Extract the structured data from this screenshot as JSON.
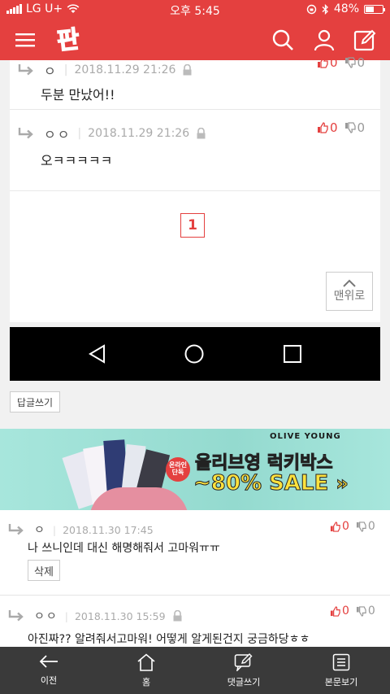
{
  "status_bar": {
    "carrier": "LG U+",
    "time": "오후 5:45",
    "battery": "48%",
    "battery_level": 0.48
  },
  "header": {
    "logo_text": "판",
    "icons": [
      "menu-icon",
      "search-icon",
      "user-icon",
      "write-icon"
    ]
  },
  "comments_top": [
    {
      "nick": "ㅇ",
      "date": "2018.11.29 21:26",
      "text": "두분 만났어!!",
      "up": "0",
      "down": "0"
    },
    {
      "nick": "ㅇㅇ",
      "date": "2018.11.29 21:26",
      "text": "오ㅋㅋㅋㅋㅋ",
      "up": "0",
      "down": "0"
    }
  ],
  "pagination": {
    "current": "1"
  },
  "to_top_label": "맨위로",
  "reply_write_label": "답글쓰기",
  "ad": {
    "brand": "OLIVE YOUNG",
    "title": "올리브영 럭키박스",
    "sale": "~80% SALE",
    "badge": "온라인 단독"
  },
  "comments_bottom": [
    {
      "nick": "ㅇ",
      "date": "2018.11.30 17:45",
      "text": "나 쓰니인데 대신 해명해줘서 고마워ㅠㅠ",
      "up": "0",
      "down": "0",
      "action": "삭제"
    },
    {
      "nick": "ㅇㅇ",
      "date": "2018.11.30 15:59",
      "text": "아진짜?? 알려줘서고마워! 어떻게 알게된건지 궁금하당ㅎㅎ",
      "up": "0",
      "down": "0"
    }
  ],
  "bottom_bar": {
    "items": [
      {
        "label": "이전",
        "icon": "back-arrow-icon"
      },
      {
        "label": "홈",
        "icon": "home-icon"
      },
      {
        "label": "댓글쓰기",
        "icon": "comment-write-icon"
      },
      {
        "label": "본문보기",
        "icon": "document-icon"
      }
    ]
  },
  "colors": {
    "brand_red": "#e4403f",
    "ad_bg": "#9ee0d6",
    "bottom_bar": "#3a3a3a"
  }
}
